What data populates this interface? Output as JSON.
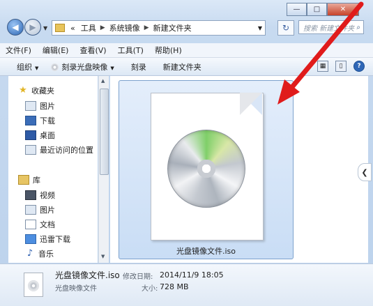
{
  "window": {
    "minimize": "—",
    "maximize": "□",
    "close": "✕"
  },
  "address": {
    "overflow": "«",
    "segments": [
      "工具",
      "系统镜像",
      "新建文件夹"
    ],
    "search_placeholder": "搜索 新建文件夹"
  },
  "menu": [
    "文件(F)",
    "编辑(E)",
    "查看(V)",
    "工具(T)",
    "帮助(H)"
  ],
  "commands": {
    "organize": "组织",
    "burn_image": "刻录光盘映像",
    "burn": "刻录",
    "new_folder": "新建文件夹"
  },
  "nav": {
    "favorites": {
      "label": "收藏夹",
      "items": [
        "图片",
        "下载",
        "桌面",
        "最近访问的位置"
      ]
    },
    "libraries": {
      "label": "库",
      "items": [
        "视频",
        "图片",
        "文档",
        "迅雷下载",
        "音乐"
      ]
    }
  },
  "file": {
    "name": "光盘镜像文件.iso"
  },
  "details": {
    "name": "光盘镜像文件.iso",
    "type": "光盘映像文件",
    "modified_label": "修改日期:",
    "modified_value": "2014/11/9 18:05",
    "size_label": "大小:",
    "size_value": "728 MB"
  },
  "icons": [
    "back-arrow-icon",
    "forward-arrow-icon",
    "folder-icon",
    "refresh-icon",
    "search-icon",
    "disc-icon",
    "star-icon",
    "help-icon"
  ],
  "colors": {
    "selection": "#c9ddf5",
    "annotation_arrow": "#e01b1b",
    "chrome": "#c7daf0"
  }
}
